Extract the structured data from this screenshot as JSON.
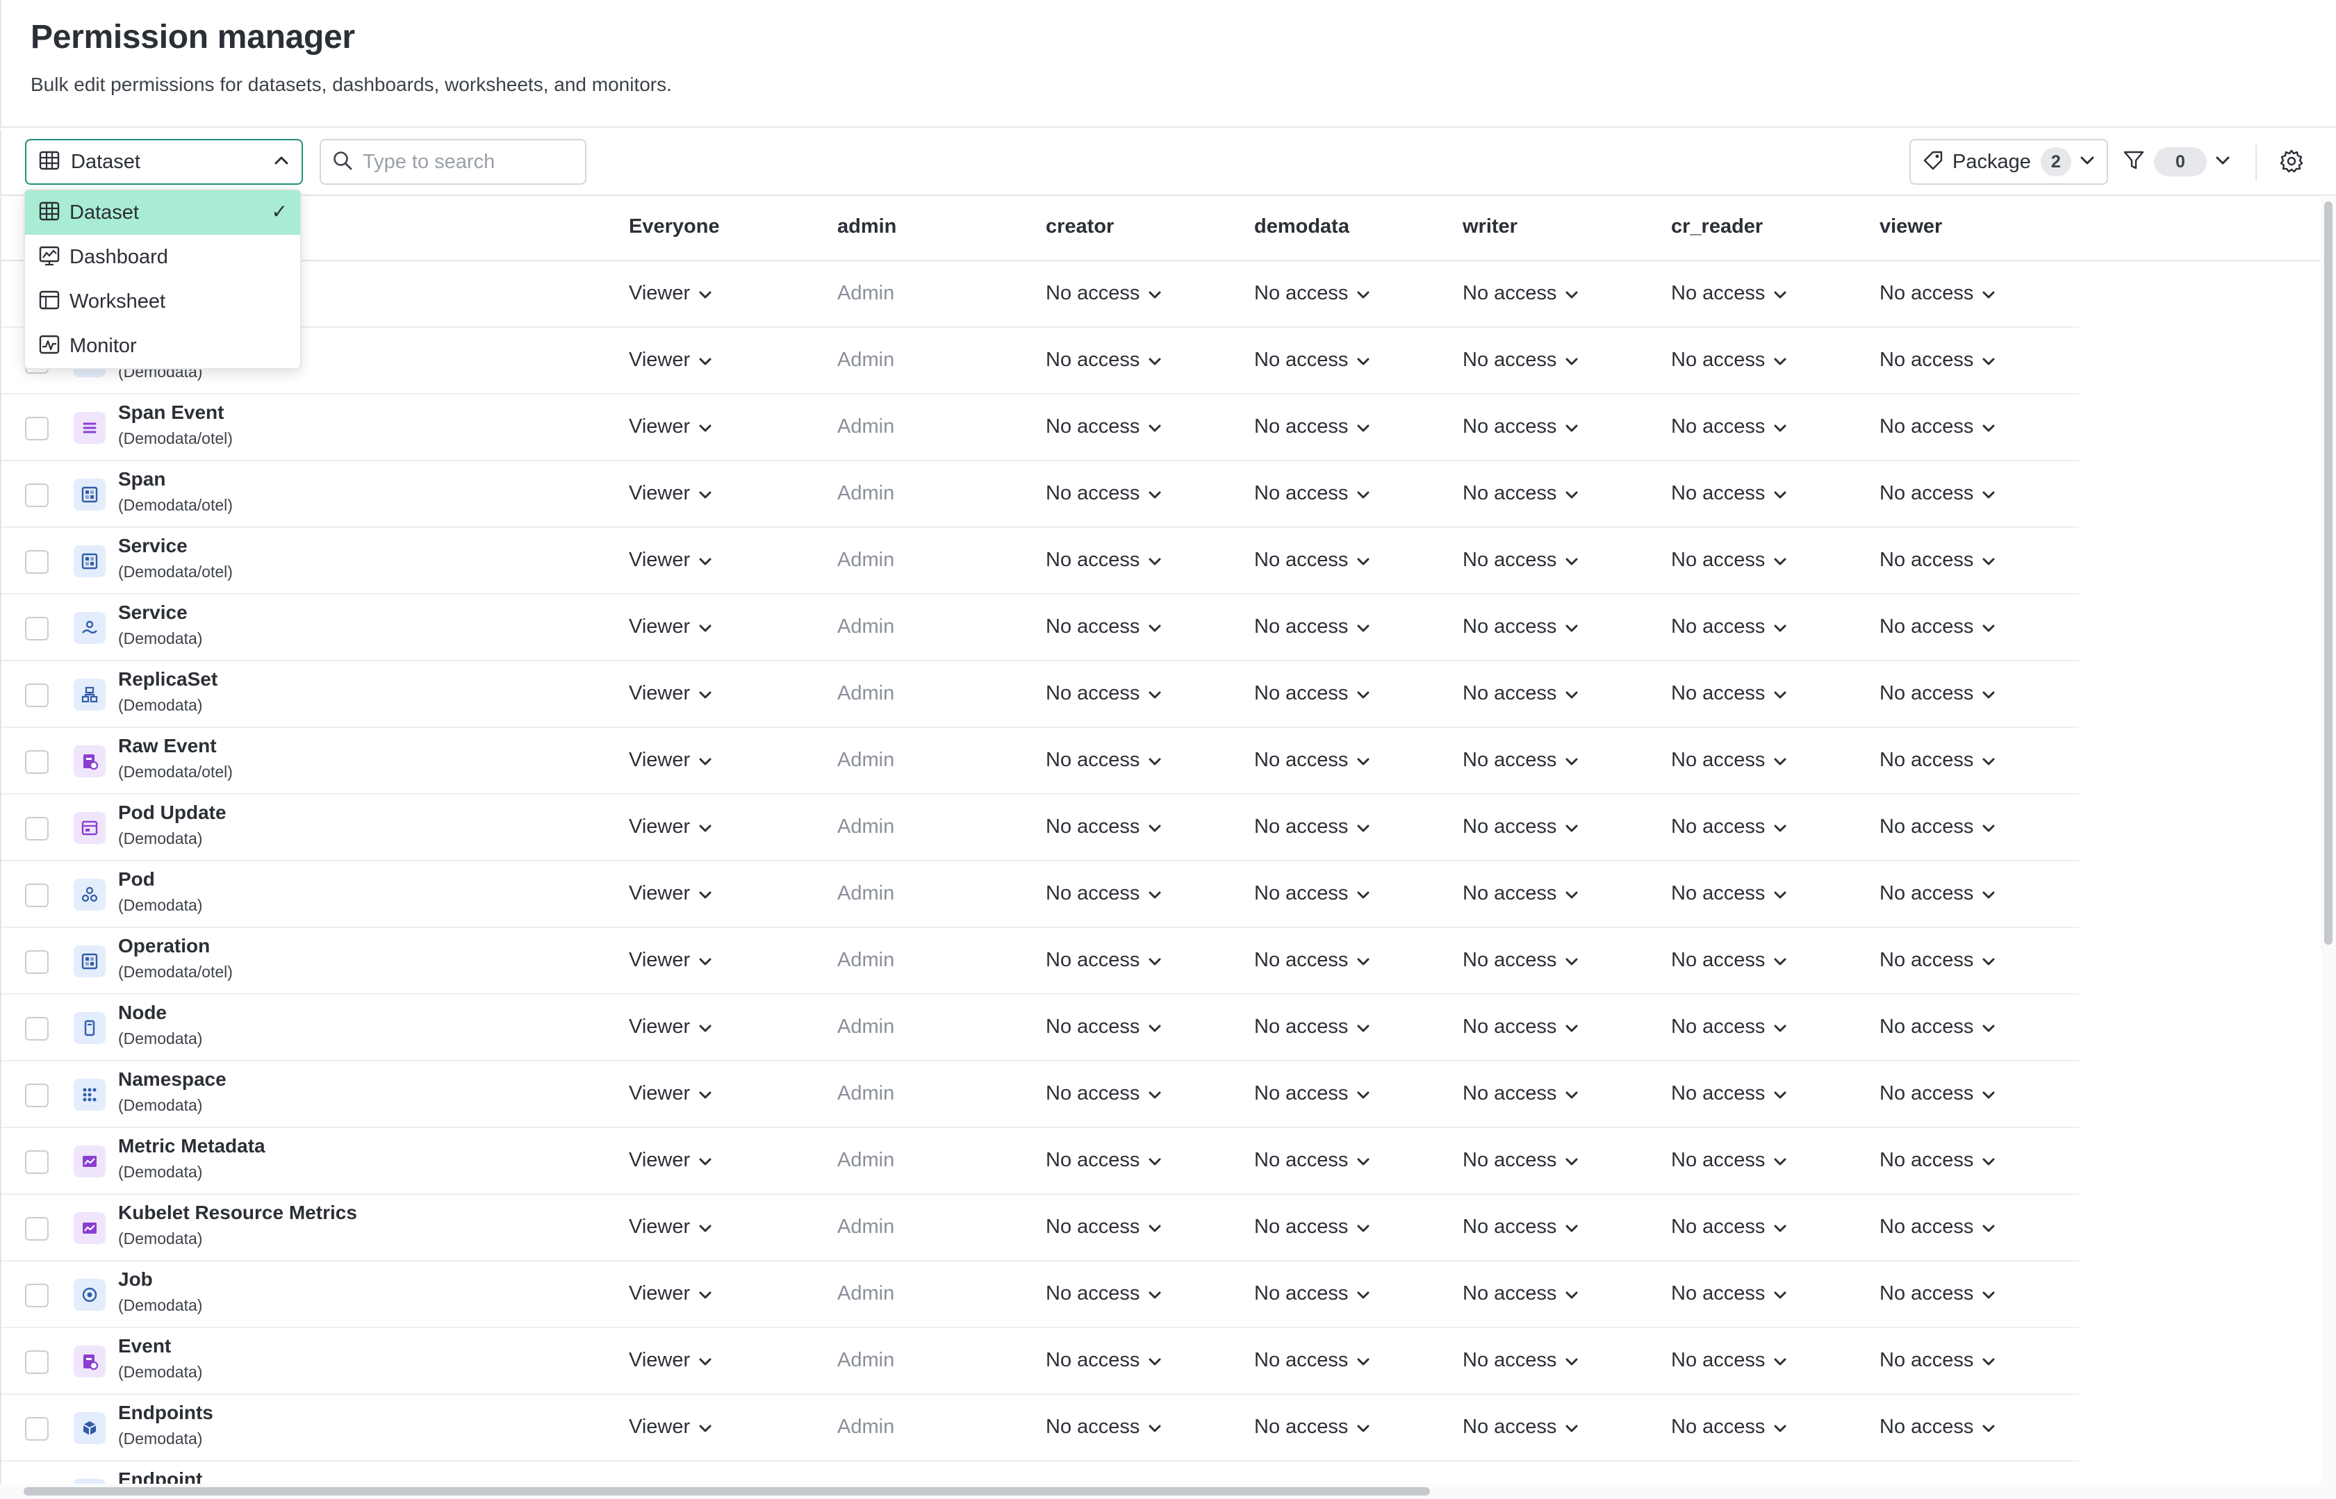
{
  "header": {
    "title": "Permission manager",
    "subtitle": "Bulk edit permissions for datasets, dashboards, worksheets, and monitors."
  },
  "toolbar": {
    "type_select": {
      "value": "Dataset",
      "icon": "table-icon",
      "chevron": "chevron-up-icon"
    },
    "search": {
      "placeholder": "Type to search",
      "value": ""
    },
    "package": {
      "label": "Package",
      "count": "2",
      "icon": "tag-icon"
    },
    "filter": {
      "count": "0",
      "icon": "funnel-icon"
    },
    "settings": {
      "icon": "gear-icon"
    }
  },
  "type_dropdown": {
    "items": [
      {
        "label": "Dataset",
        "icon": "table-icon",
        "selected": true,
        "check": "✓"
      },
      {
        "label": "Dashboard",
        "icon": "dashboard-icon",
        "selected": false
      },
      {
        "label": "Worksheet",
        "icon": "worksheet-icon",
        "selected": false
      },
      {
        "label": "Monitor",
        "icon": "monitor-icon",
        "selected": false
      }
    ]
  },
  "table": {
    "columns": [
      "Everyone",
      "admin",
      "creator",
      "demodata",
      "writer",
      "cr_reader",
      "viewer"
    ],
    "rows": [
      {
        "name": "",
        "path": "",
        "icon": "dataset-icon",
        "icon_color": "blue",
        "perms": [
          "Viewer",
          "Admin",
          "No access",
          "No access",
          "No access",
          "No access",
          "No access"
        ]
      },
      {
        "name": "",
        "path": "(Demodata)",
        "icon": "dataset-icon",
        "icon_color": "blue",
        "perms": [
          "Viewer",
          "Admin",
          "No access",
          "No access",
          "No access",
          "No access",
          "No access"
        ]
      },
      {
        "name": "Span Event",
        "path": "(Demodata/otel)",
        "icon": "list-icon",
        "icon_color": "purple",
        "perms": [
          "Viewer",
          "Admin",
          "No access",
          "No access",
          "No access",
          "No access",
          "No access"
        ]
      },
      {
        "name": "Span",
        "path": "(Demodata/otel)",
        "icon": "grid-icon",
        "icon_color": "blue",
        "perms": [
          "Viewer",
          "Admin",
          "No access",
          "No access",
          "No access",
          "No access",
          "No access"
        ]
      },
      {
        "name": "Service",
        "path": "(Demodata/otel)",
        "icon": "grid-icon",
        "icon_color": "blue",
        "perms": [
          "Viewer",
          "Admin",
          "No access",
          "No access",
          "No access",
          "No access",
          "No access"
        ]
      },
      {
        "name": "Service",
        "path": "(Demodata)",
        "icon": "service-icon",
        "icon_color": "blue",
        "perms": [
          "Viewer",
          "Admin",
          "No access",
          "No access",
          "No access",
          "No access",
          "No access"
        ]
      },
      {
        "name": "ReplicaSet",
        "path": "(Demodata)",
        "icon": "replicaset-icon",
        "icon_color": "blue",
        "perms": [
          "Viewer",
          "Admin",
          "No access",
          "No access",
          "No access",
          "No access",
          "No access"
        ]
      },
      {
        "name": "Raw Event",
        "path": "(Demodata/otel)",
        "icon": "event-icon",
        "icon_color": "purple",
        "perms": [
          "Viewer",
          "Admin",
          "No access",
          "No access",
          "No access",
          "No access",
          "No access"
        ]
      },
      {
        "name": "Pod Update",
        "path": "(Demodata)",
        "icon": "update-icon",
        "icon_color": "purple",
        "perms": [
          "Viewer",
          "Admin",
          "No access",
          "No access",
          "No access",
          "No access",
          "No access"
        ]
      },
      {
        "name": "Pod",
        "path": "(Demodata)",
        "icon": "pod-icon",
        "icon_color": "blue",
        "perms": [
          "Viewer",
          "Admin",
          "No access",
          "No access",
          "No access",
          "No access",
          "No access"
        ]
      },
      {
        "name": "Operation",
        "path": "(Demodata/otel)",
        "icon": "grid-icon",
        "icon_color": "blue",
        "perms": [
          "Viewer",
          "Admin",
          "No access",
          "No access",
          "No access",
          "No access",
          "No access"
        ]
      },
      {
        "name": "Node",
        "path": "(Demodata)",
        "icon": "node-icon",
        "icon_color": "blue",
        "perms": [
          "Viewer",
          "Admin",
          "No access",
          "No access",
          "No access",
          "No access",
          "No access"
        ]
      },
      {
        "name": "Namespace",
        "path": "(Demodata)",
        "icon": "namespace-icon",
        "icon_color": "blue",
        "perms": [
          "Viewer",
          "Admin",
          "No access",
          "No access",
          "No access",
          "No access",
          "No access"
        ]
      },
      {
        "name": "Metric Metadata",
        "path": "(Demodata)",
        "icon": "metric-icon",
        "icon_color": "purple",
        "perms": [
          "Viewer",
          "Admin",
          "No access",
          "No access",
          "No access",
          "No access",
          "No access"
        ]
      },
      {
        "name": "Kubelet Resource Metrics",
        "path": "(Demodata)",
        "icon": "metric-icon",
        "icon_color": "purple",
        "perms": [
          "Viewer",
          "Admin",
          "No access",
          "No access",
          "No access",
          "No access",
          "No access"
        ]
      },
      {
        "name": "Job",
        "path": "(Demodata)",
        "icon": "job-icon",
        "icon_color": "blue",
        "perms": [
          "Viewer",
          "Admin",
          "No access",
          "No access",
          "No access",
          "No access",
          "No access"
        ]
      },
      {
        "name": "Event",
        "path": "(Demodata)",
        "icon": "event-icon",
        "icon_color": "purple",
        "perms": [
          "Viewer",
          "Admin",
          "No access",
          "No access",
          "No access",
          "No access",
          "No access"
        ]
      },
      {
        "name": "Endpoints",
        "path": "(Demodata)",
        "icon": "cube-icon",
        "icon_color": "blue",
        "perms": [
          "Viewer",
          "Admin",
          "No access",
          "No access",
          "No access",
          "No access",
          "No access"
        ]
      },
      {
        "name": "Endpoint",
        "path": "",
        "icon": "dataset-icon",
        "icon_color": "blue",
        "perms": []
      }
    ]
  },
  "colors": {
    "accent": "#1f8f7a",
    "selected_bg": "#a9ecd4",
    "icon_purple_bg": "#efe6fb",
    "icon_purple_fg": "#8a3fd1",
    "icon_blue_bg": "#e3edfb",
    "icon_blue_fg": "#2f5da8"
  }
}
